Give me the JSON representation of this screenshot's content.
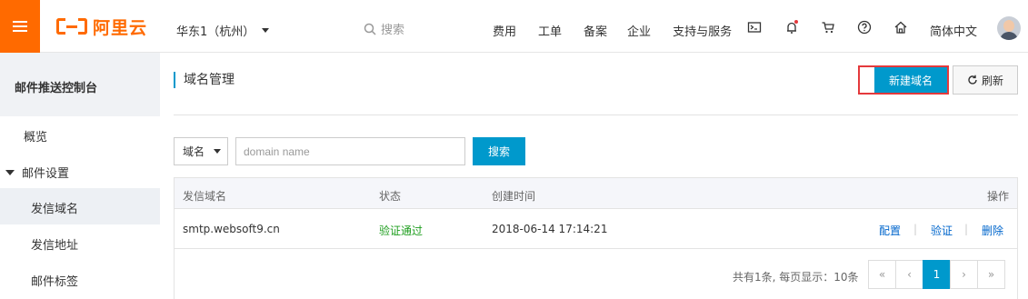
{
  "topbar": {
    "brand": "阿里云",
    "region": "华东1（杭州）",
    "search_placeholder": "搜索",
    "nav": [
      "费用",
      "工单",
      "备案",
      "企业",
      "支持与服务"
    ],
    "language": "简体中文",
    "icons": [
      "terminal-icon",
      "bell-icon",
      "cart-icon",
      "help-icon",
      "home-icon"
    ]
  },
  "sidebar": {
    "title": "邮件推送控制台",
    "overview": "概览",
    "group": "邮件设置",
    "items": [
      "发信域名",
      "发信地址",
      "邮件标签"
    ],
    "active_index": 0
  },
  "main": {
    "title": "域名管理",
    "new_domain_button": "新建域名",
    "refresh_button": "刷新",
    "filter_select": "域名",
    "input_placeholder": "domain name",
    "search_button": "搜索",
    "columns": [
      "发信域名",
      "状态",
      "创建时间",
      "操作"
    ],
    "rows": [
      {
        "domain": "smtp.websoft9.cn",
        "status": "验证通过",
        "created": "2018-06-14 17:14:21",
        "actions": [
          "配置",
          "验证",
          "删除"
        ]
      }
    ],
    "pager_info": "共有1条, 每页显示：10条",
    "pager": [
      "«",
      "‹",
      "1",
      "›",
      "»"
    ],
    "current_page": "1"
  },
  "colors": {
    "brand_orange": "#ff6a00",
    "primary_blue": "#0099cc",
    "success_green": "#1e9e1e",
    "highlight_red": "#e4393c"
  }
}
